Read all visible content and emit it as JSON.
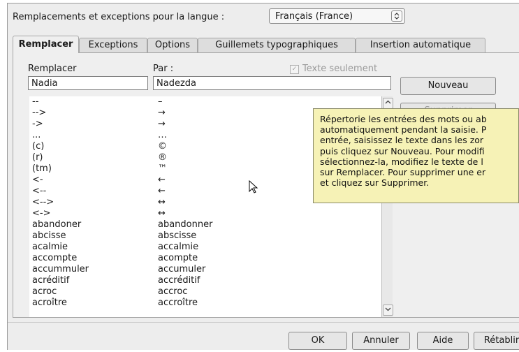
{
  "header": {
    "language_label": "Remplacements et exceptions pour la langue :",
    "language_value": "Français (France)"
  },
  "tabs": [
    {
      "label": "Remplacer",
      "active": true
    },
    {
      "label": "Exceptions",
      "active": false
    },
    {
      "label": "Options",
      "active": false
    },
    {
      "label": "Guillemets typographiques",
      "active": false
    },
    {
      "label": "Insertion automatique",
      "active": false
    }
  ],
  "replace_panel": {
    "replace_label": "Remplacer",
    "with_label": "Par :",
    "text_only_label": "Texte seulement",
    "text_only_checked": true,
    "replace_value": "Nadia",
    "with_value": "Nadezda",
    "new_button": "Nouveau",
    "delete_button": "Supprimer"
  },
  "list": {
    "rows": [
      {
        "from": "--",
        "to": "–"
      },
      {
        "from": "-->",
        "to": "→"
      },
      {
        "from": "->",
        "to": "→"
      },
      {
        "from": "...",
        "to": "…"
      },
      {
        "from": "(c)",
        "to": "©"
      },
      {
        "from": "(r)",
        "to": "®"
      },
      {
        "from": "(tm)",
        "to": "™"
      },
      {
        "from": "<-",
        "to": "←"
      },
      {
        "from": "<--",
        "to": "←"
      },
      {
        "from": "<-->",
        "to": "↔"
      },
      {
        "from": "<->",
        "to": "↔"
      },
      {
        "from": "abandoner",
        "to": "abandonner"
      },
      {
        "from": "abcisse",
        "to": "abscisse"
      },
      {
        "from": "acalmie",
        "to": "accalmie"
      },
      {
        "from": "accompte",
        "to": "acompte"
      },
      {
        "from": "accummuler",
        "to": "accumuler"
      },
      {
        "from": "acréditif",
        "to": "accréditif"
      },
      {
        "from": "acroc",
        "to": "accroc"
      },
      {
        "from": "acroître",
        "to": "accroître"
      }
    ]
  },
  "tooltip": {
    "text": "Répertorie les entrées des mots ou ab\nautomatiquement pendant la saisie. P\nentrée, saisissez le texte dans les zor\npuis cliquez sur Nouveau. Pour modifi\nsélectionnez-la, modifiez le texte de l\nsur Remplacer. Pour supprimer une er\net cliquez sur Supprimer."
  },
  "footer": {
    "ok": "OK",
    "cancel": "Annuler",
    "help": "Aide",
    "reset": "Rétablir"
  },
  "icons": {
    "spin": "spin-updown-icon",
    "scroll_up": "chevron-up-icon",
    "scroll_down": "chevron-down-icon",
    "cursor": "mouse-pointer-icon"
  },
  "colors": {
    "dialog_bg": "#ededed",
    "tooltip_bg": "#f6f2b6",
    "list_bg": "#ffffff"
  }
}
